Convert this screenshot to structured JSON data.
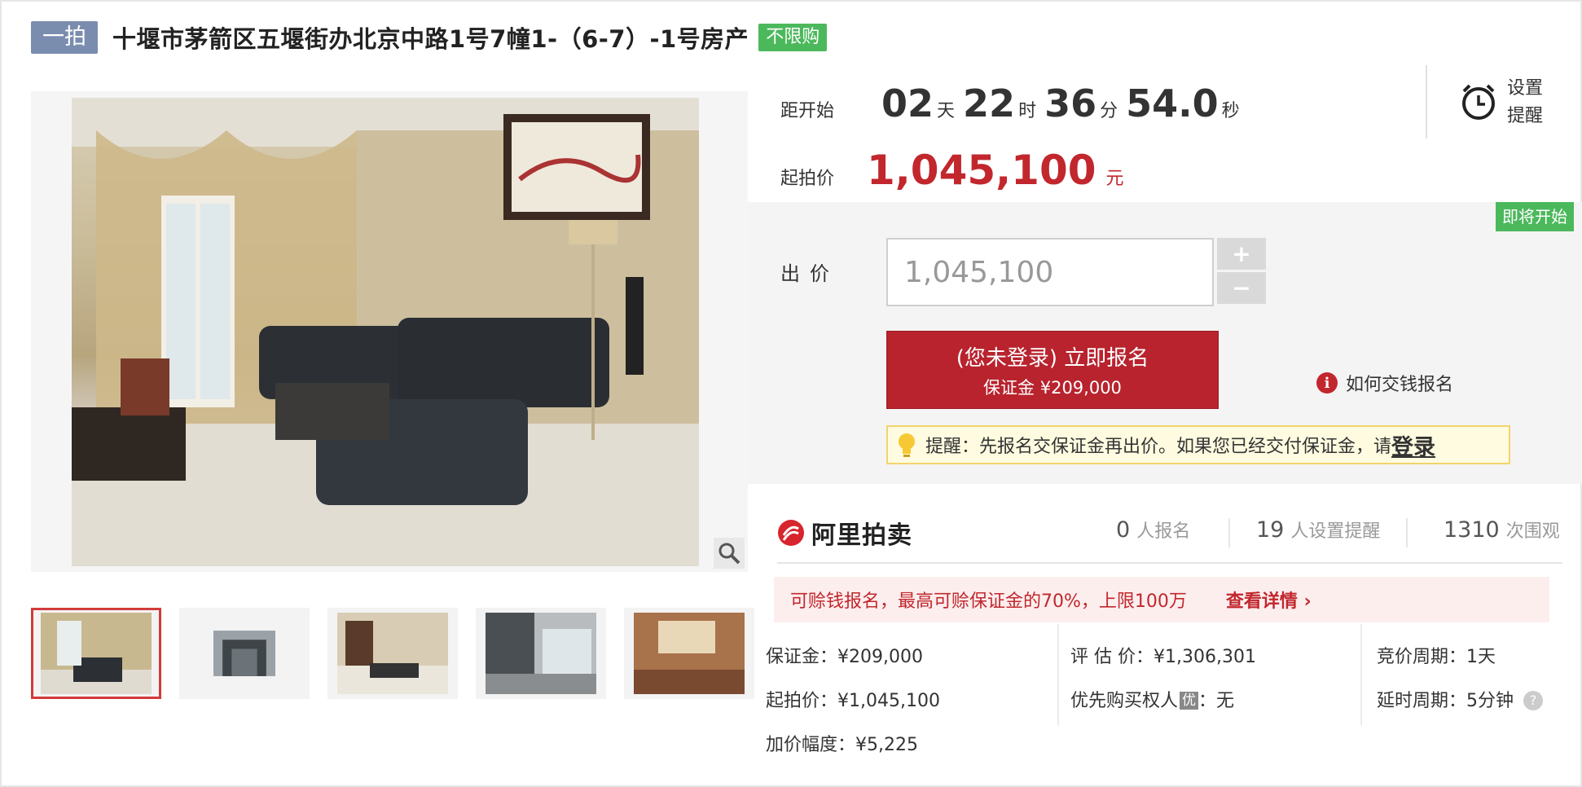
{
  "title": {
    "round": "一拍",
    "name": "十堰市茅箭区五堰街办北京中路1号7幢1-（6-7）-1号房产",
    "purchase_tag": "不限购"
  },
  "gallery": {
    "main_photo_alt": "living room",
    "thumbnail_count": 5,
    "active_thumbnail": 1
  },
  "countdown": {
    "label": "距开始",
    "days": "02",
    "days_unit": "天",
    "hours": "22",
    "hours_unit": "时",
    "minutes": "36",
    "minutes_unit": "分",
    "seconds": "54.0",
    "seconds_unit": "秒"
  },
  "reminder": {
    "line1": "设置",
    "line2": "提醒"
  },
  "start_price": {
    "label": "起拍价",
    "value": "1,045,100",
    "unit": "元"
  },
  "bid": {
    "status_tag": "即将开始",
    "label": "出价",
    "input_value": "1,045,100",
    "plus": "+",
    "minus": "−",
    "signup_main": "(您未登录) 立即报名",
    "signup_sub": "保证金 ¥209,000",
    "howto": "如何交钱报名",
    "notice_text": "提醒：先报名交保证金再出价。如果您已经交付保证金，请",
    "notice_login": "登录"
  },
  "stats": {
    "brand": "阿里拍卖",
    "signups": "0",
    "signups_label": "人报名",
    "reminders": "19",
    "reminders_label": "人设置提醒",
    "views": "1310",
    "views_label": "次围观"
  },
  "promo": {
    "text": "可赊钱报名，最高可赊保证金的70%，上限100万",
    "link": "查看详情 ›"
  },
  "details": {
    "deposit": "保证金：¥209,000",
    "start": "起拍价：¥1,045,100",
    "increment": "加价幅度：¥5,225",
    "appraisal": "评 估 价：¥1,306,301",
    "priority_label": "优先购买权人",
    "priority_badge": "优",
    "priority_value": "：无",
    "period": "竞价周期：1天",
    "extension": "延时周期：5分钟",
    "help": "?"
  }
}
